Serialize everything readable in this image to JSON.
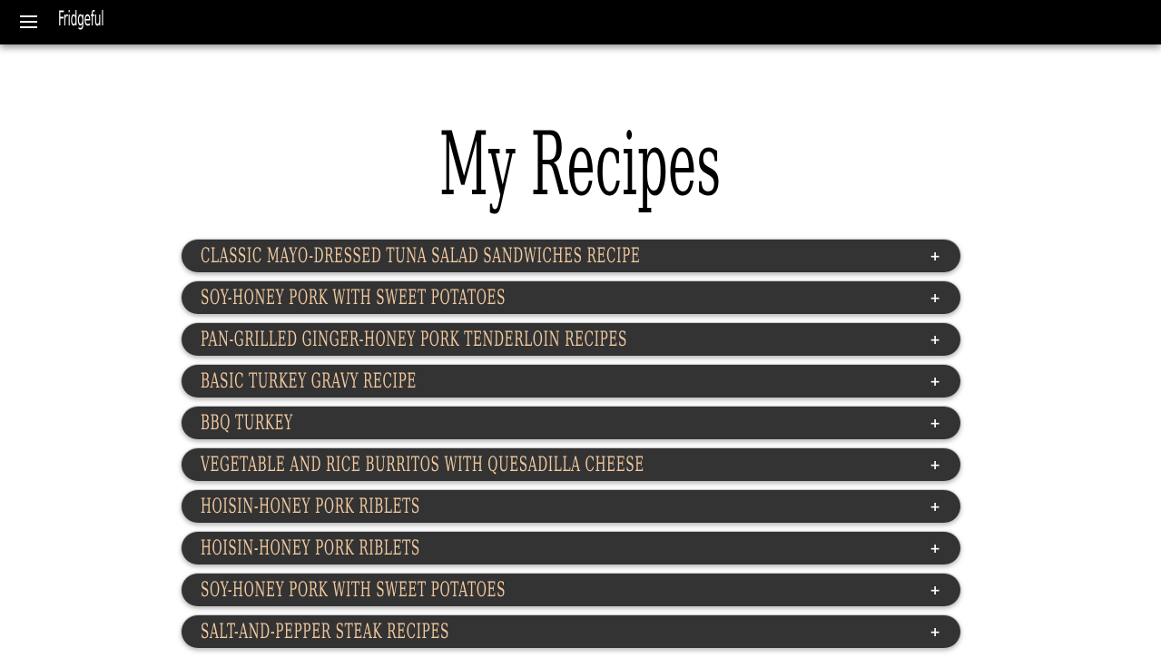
{
  "header": {
    "brand": "Fridgeful"
  },
  "main": {
    "title": "My Recipes",
    "expand_symbol": "+",
    "recipes": [
      {
        "name": "Classic Mayo-Dressed Tuna Salad Sandwiches Recipe"
      },
      {
        "name": "Soy-Honey Pork with Sweet Potatoes"
      },
      {
        "name": "Pan-Grilled Ginger-Honey Pork Tenderloin Recipes"
      },
      {
        "name": "Basic Turkey Gravy Recipe"
      },
      {
        "name": "BBQ Turkey"
      },
      {
        "name": "Vegetable and Rice Burritos with Quesadilla Cheese"
      },
      {
        "name": "Hoisin-Honey Pork Riblets"
      },
      {
        "name": "Hoisin-Honey Pork Riblets"
      },
      {
        "name": "Soy-Honey Pork with Sweet Potatoes"
      },
      {
        "name": "Salt-and-Pepper Steak Recipes"
      }
    ]
  },
  "colors": {
    "topbar": "#000000",
    "item_background": "#333333",
    "item_text": "#f1c9a0"
  },
  "icons": {
    "menu": "hamburger-menu-icon",
    "expand": "plus-icon"
  }
}
